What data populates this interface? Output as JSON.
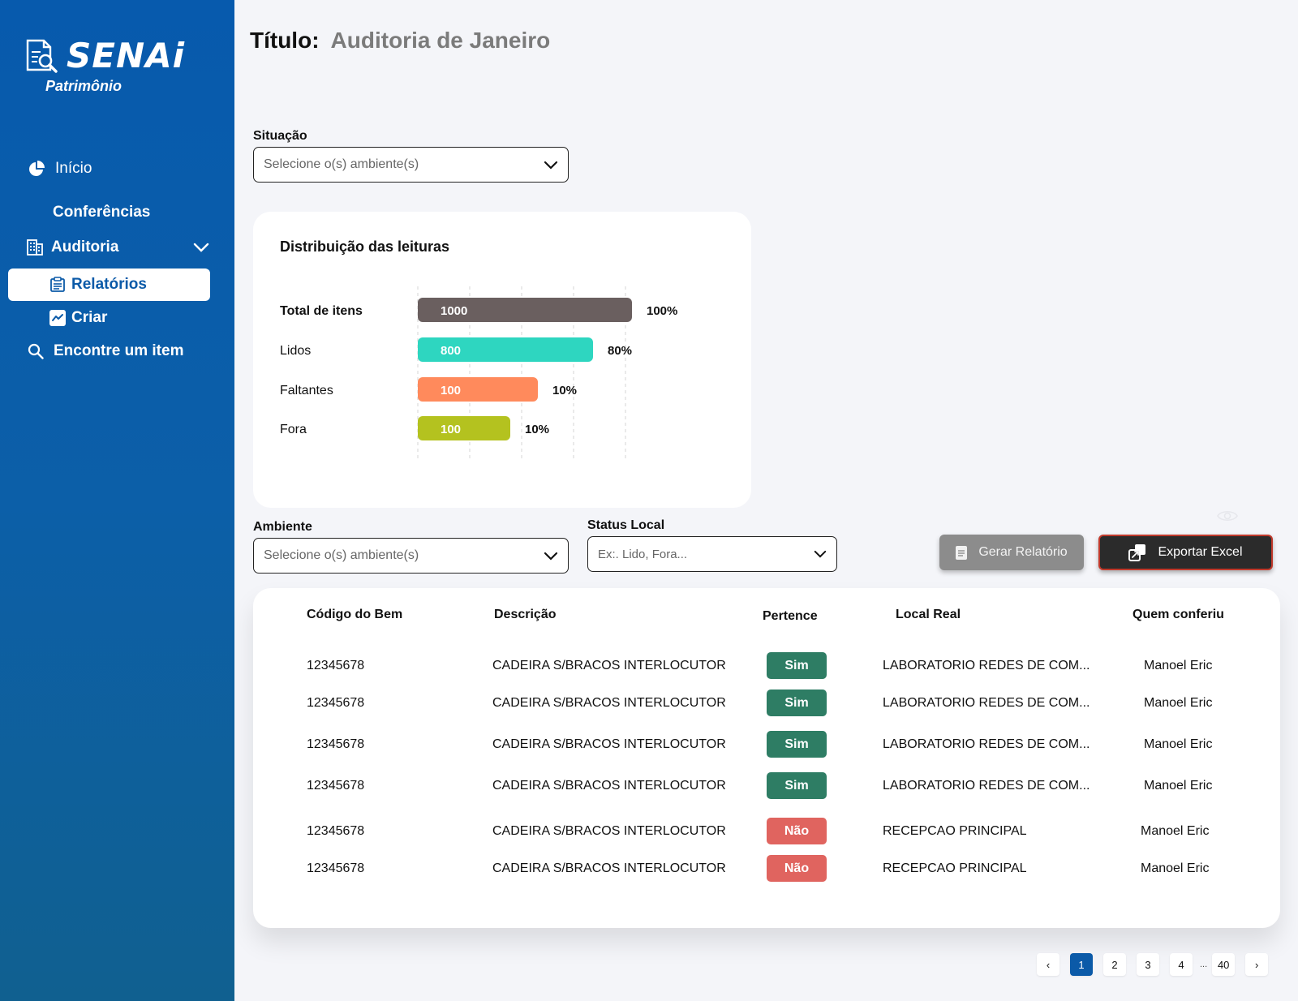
{
  "sidebar": {
    "logo_text": "SENAi",
    "logo_sub": "Patrimônio",
    "items": {
      "inicio": "Início",
      "conferencias": "Conferências",
      "auditoria": "Auditoria",
      "relatorios": "Relatórios",
      "criar": "Criar",
      "encontre": "Encontre um item"
    },
    "active_item": "relatorios",
    "icons": [
      "document-search-icon",
      "pie-chart-icon",
      "building-icon",
      "chevron-down-icon",
      "clipboard-icon",
      "chart-line-icon",
      "search-icon"
    ]
  },
  "header": {
    "title_label": "Título:",
    "title_value": "Auditoria de Janeiro"
  },
  "filters": {
    "situacao_label": "Situação",
    "situacao_placeholder": "Selecione o(s) ambiente(s)",
    "ambiente_label": "Ambiente",
    "ambiente_placeholder": "Selecione o(s) ambiente(s)",
    "status_label": "Status Local",
    "status_placeholder": "Ex:. Lido, Fora..."
  },
  "chart_data": {
    "type": "bar",
    "orientation": "horizontal",
    "title": "Distribuição das leituras",
    "categories": [
      "Total de itens",
      "Lidos",
      "Faltantes",
      "Fora"
    ],
    "values": [
      1000,
      800,
      100,
      100
    ],
    "percent_labels": [
      "100%",
      "80%",
      "10%",
      "10%"
    ],
    "colors": [
      "#6a5f5f",
      "#2ed6c0",
      "#ff8a5c",
      "#b4c21f"
    ],
    "grid": true
  },
  "actions": {
    "gerar_label": "Gerar Relatório",
    "exportar_label": "Exportar Excel"
  },
  "table": {
    "headers": [
      "Código do Bem",
      "Descrição",
      "Pertence",
      "Local Real",
      "Quem conferiu"
    ],
    "rows": [
      {
        "codigo": "12345678",
        "descricao": "CADEIRA S/BRACOS INTERLOCUTOR",
        "pertence": "Sim",
        "local": "LABORATORIO REDES DE COM...",
        "quem": "Manoel Eric"
      },
      {
        "codigo": "12345678",
        "descricao": "CADEIRA S/BRACOS INTERLOCUTOR",
        "pertence": "Sim",
        "local": "LABORATORIO REDES DE COM...",
        "quem": "Manoel Eric"
      },
      {
        "codigo": "12345678",
        "descricao": "CADEIRA S/BRACOS INTERLOCUTOR",
        "pertence": "Sim",
        "local": "LABORATORIO REDES DE COM...",
        "quem": "Manoel Eric"
      },
      {
        "codigo": "12345678",
        "descricao": "CADEIRA S/BRACOS INTERLOCUTOR",
        "pertence": "Sim",
        "local": "LABORATORIO REDES DE COM...",
        "quem": "Manoel Eric"
      },
      {
        "codigo": "12345678",
        "descricao": "CADEIRA S/BRACOS INTERLOCUTOR",
        "pertence": "Não",
        "local": "RECEPCAO PRINCIPAL",
        "quem": "Manoel Eric"
      },
      {
        "codigo": "12345678",
        "descricao": "CADEIRA S/BRACOS INTERLOCUTOR",
        "pertence": "Não",
        "local": "RECEPCAO PRINCIPAL",
        "quem": "Manoel Eric"
      }
    ],
    "badge_colors": {
      "Sim": "#2e7d64",
      "Não": "#e0645f"
    }
  },
  "pagination": {
    "prev": "‹",
    "pages": [
      "1",
      "2",
      "3",
      "4"
    ],
    "ellipsis": "...",
    "last": "40",
    "next": "›",
    "current": "1"
  }
}
